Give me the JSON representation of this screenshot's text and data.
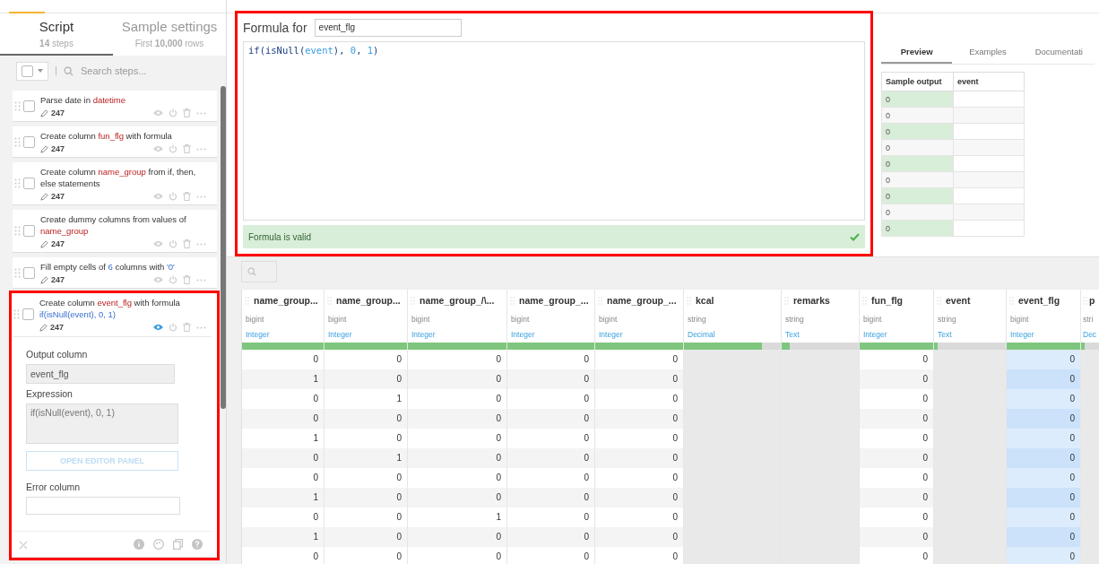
{
  "sidebar": {
    "tabs": [
      {
        "label": "Script",
        "sub": "**14** steps",
        "selected": true
      },
      {
        "label": "Sample settings",
        "sub": "First **10,000** rows",
        "selected": false
      }
    ],
    "search": {
      "placeholder": "Search steps..."
    },
    "steps": [
      {
        "parts": [
          {
            "kind": "plain",
            "text": "Parse date in "
          },
          {
            "kind": "column",
            "text": "datetime"
          }
        ],
        "count": "247",
        "expanded": false,
        "highlighted": false,
        "preview_on": false
      },
      {
        "parts": [
          {
            "kind": "plain",
            "text": "Create column "
          },
          {
            "kind": "column",
            "text": "fun_flg"
          },
          {
            "kind": "plain",
            "text": " with formula"
          }
        ],
        "count": "247",
        "expanded": false,
        "highlighted": false,
        "preview_on": false
      },
      {
        "parts": [
          {
            "kind": "plain",
            "text": "Create column "
          },
          {
            "kind": "column",
            "text": "name_group"
          },
          {
            "kind": "plain",
            "text": " from if, then, else statements"
          }
        ],
        "count": "247",
        "expanded": false,
        "highlighted": false,
        "preview_on": false
      },
      {
        "parts": [
          {
            "kind": "plain",
            "text": "Create dummy columns from values of "
          },
          {
            "kind": "column",
            "text": "name_group"
          }
        ],
        "count": "247",
        "expanded": false,
        "highlighted": false,
        "preview_on": false
      },
      {
        "parts": [
          {
            "kind": "plain",
            "text": "Fill empty cells of "
          },
          {
            "kind": "value",
            "text": "6"
          },
          {
            "kind": "plain",
            "text": " columns with "
          },
          {
            "kind": "value",
            "text": "'0'"
          }
        ],
        "count": "247",
        "expanded": false,
        "highlighted": false,
        "preview_on": false
      },
      {
        "parts": [
          {
            "kind": "plain",
            "text": "Create column "
          },
          {
            "kind": "column",
            "text": "event_flg"
          },
          {
            "kind": "plain",
            "text": " with formula "
          },
          {
            "kind": "value",
            "text": "if(isNull(event), 0, 1)"
          }
        ],
        "count": "247",
        "expanded": true,
        "highlighted": true,
        "preview_on": true,
        "form": {
          "output_label": "Output column",
          "output_value": "event_flg",
          "expression_label": "Expression",
          "expression_value": "if(isNull(event), 0, 1)",
          "editor_button": "OPEN EDITOR PANEL",
          "error_label": "Error column"
        }
      }
    ]
  },
  "formula": {
    "label": "Formula for",
    "column": "event_flg",
    "highlighted": true,
    "code": [
      {
        "kind": "fn",
        "text": "if(isNull("
      },
      {
        "kind": "ref",
        "text": "event"
      },
      {
        "kind": "fn",
        "text": "), "
      },
      {
        "kind": "num",
        "text": "0"
      },
      {
        "kind": "fn",
        "text": ", "
      },
      {
        "kind": "num",
        "text": "1"
      },
      {
        "kind": "fn",
        "text": ")"
      }
    ],
    "status": "Formula is valid",
    "valid": true
  },
  "preview": {
    "tabs": [
      {
        "label": "Preview",
        "selected": true
      },
      {
        "label": "Examples",
        "selected": false
      },
      {
        "label": "Documentati",
        "selected": false
      }
    ],
    "columns": [
      "Sample output",
      "event"
    ],
    "rows": [
      [
        "0",
        ""
      ],
      [
        "0",
        ""
      ],
      [
        "0",
        ""
      ],
      [
        "0",
        ""
      ],
      [
        "0",
        ""
      ],
      [
        "0",
        ""
      ],
      [
        "0",
        ""
      ],
      [
        "0",
        ""
      ],
      [
        "0",
        ""
      ]
    ]
  },
  "table": {
    "columns": [
      {
        "name": "name_group...",
        "storage": "bigint",
        "meaning": "Integer",
        "level": 1,
        "null": false,
        "selected": false
      },
      {
        "name": "name_group...",
        "storage": "bigint",
        "meaning": "Integer",
        "level": 1,
        "null": false,
        "selected": false
      },
      {
        "name": "name_group_/\\...",
        "storage": "bigint",
        "meaning": "Integer",
        "level": 1,
        "null": false,
        "selected": false
      },
      {
        "name": "name_group_...",
        "storage": "bigint",
        "meaning": "Integer",
        "level": 1,
        "null": false,
        "selected": false
      },
      {
        "name": "name_group_...",
        "storage": "bigint",
        "meaning": "Integer",
        "level": 1,
        "null": false,
        "selected": false
      },
      {
        "name": "kcal",
        "storage": "string",
        "meaning": "Decimal",
        "level": 0.81,
        "null": true,
        "selected": false
      },
      {
        "name": "remarks",
        "storage": "string",
        "meaning": "Text",
        "level": 0.1,
        "null": true,
        "selected": false
      },
      {
        "name": "fun_flg",
        "storage": "bigint",
        "meaning": "Integer",
        "level": 1,
        "null": false,
        "selected": false
      },
      {
        "name": "event",
        "storage": "string",
        "meaning": "Text",
        "level": 0.05,
        "null": true,
        "selected": false
      },
      {
        "name": "event_flg",
        "storage": "bigint",
        "meaning": "Integer",
        "level": 1,
        "null": false,
        "selected": true
      },
      {
        "name": "p",
        "storage": "stri",
        "meaning": "Dec",
        "level": 0.2,
        "null": true,
        "selected": false
      }
    ],
    "rows": [
      [
        "0",
        "0",
        "0",
        "0",
        "0",
        "",
        "",
        "0",
        "",
        "0",
        ""
      ],
      [
        "1",
        "0",
        "0",
        "0",
        "0",
        "",
        "",
        "0",
        "",
        "0",
        ""
      ],
      [
        "0",
        "1",
        "0",
        "0",
        "0",
        "",
        "",
        "0",
        "",
        "0",
        ""
      ],
      [
        "0",
        "0",
        "0",
        "0",
        "0",
        "",
        "",
        "0",
        "",
        "0",
        ""
      ],
      [
        "1",
        "0",
        "0",
        "0",
        "0",
        "",
        "",
        "0",
        "",
        "0",
        ""
      ],
      [
        "0",
        "1",
        "0",
        "0",
        "0",
        "",
        "",
        "0",
        "",
        "0",
        ""
      ],
      [
        "0",
        "0",
        "0",
        "0",
        "0",
        "",
        "",
        "0",
        "",
        "0",
        ""
      ],
      [
        "1",
        "0",
        "0",
        "0",
        "0",
        "",
        "",
        "0",
        "",
        "0",
        ""
      ],
      [
        "0",
        "0",
        "1",
        "0",
        "0",
        "",
        "",
        "0",
        "",
        "0",
        ""
      ],
      [
        "1",
        "0",
        "0",
        "0",
        "0",
        "",
        "",
        "0",
        "",
        "0",
        ""
      ],
      [
        "0",
        "0",
        "0",
        "0",
        "0",
        "",
        "",
        "0",
        "",
        "0",
        ""
      ]
    ]
  }
}
